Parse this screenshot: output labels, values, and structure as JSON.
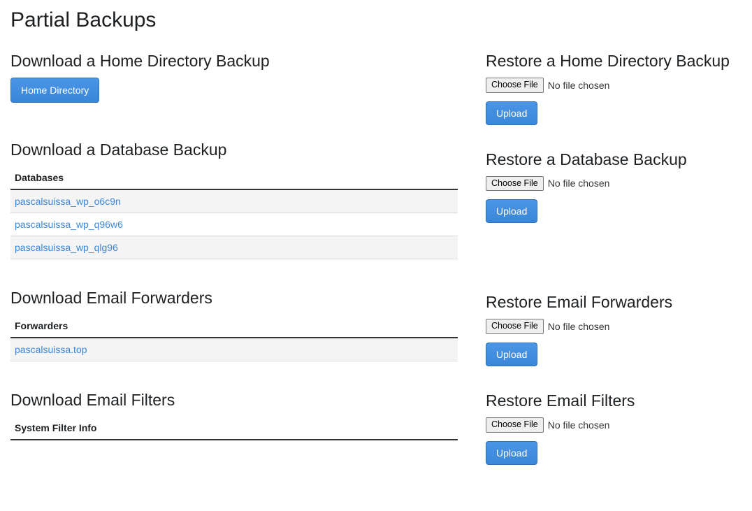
{
  "page_title": "Partial Backups",
  "download_home": {
    "title": "Download a Home Directory Backup",
    "button": "Home Directory"
  },
  "restore_home": {
    "title": "Restore a Home Directory Backup",
    "choose_file": "Choose File",
    "file_status": "No file chosen",
    "upload": "Upload"
  },
  "download_db": {
    "title": "Download a Database Backup",
    "table_header": "Databases",
    "rows": [
      "pascalsuissa_wp_o6c9n",
      "pascalsuissa_wp_q96w6",
      "pascalsuissa_wp_qlg96"
    ]
  },
  "restore_db": {
    "title": "Restore a Database Backup",
    "choose_file": "Choose File",
    "file_status": "No file chosen",
    "upload": "Upload"
  },
  "download_fwd": {
    "title": "Download Email Forwarders",
    "table_header": "Forwarders",
    "rows": [
      "pascalsuissa.top"
    ]
  },
  "restore_fwd": {
    "title": "Restore Email Forwarders",
    "choose_file": "Choose File",
    "file_status": "No file chosen",
    "upload": "Upload"
  },
  "download_filters": {
    "title": "Download Email Filters",
    "table_header": "System Filter Info"
  },
  "restore_filters": {
    "title": "Restore Email Filters",
    "choose_file": "Choose File",
    "file_status": "No file chosen",
    "upload": "Upload"
  }
}
